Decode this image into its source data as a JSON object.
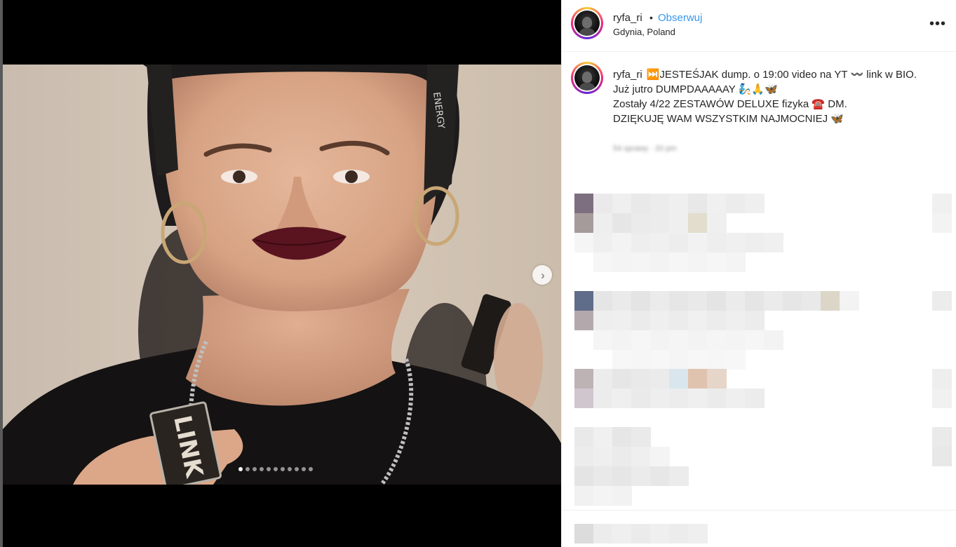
{
  "post": {
    "username": "ryfa_ri",
    "separator": "•",
    "follow_label": "Obserwuj",
    "location": "Gdynia, Poland",
    "more_icon": "more-options-icon",
    "caption": {
      "username": "ryfa_ri",
      "line1": "⏭️JESTEŚJAK dump. o 19:00 video na YT 〰️ link w BIO.",
      "line2": "Już jutro DUMPDAAAAAY 🧞🙏🦋",
      "line3": "Zostały 4/22 ZESTAWÓW DELUXE fizyka ☎️ DM.",
      "line4": "DZIĘKUJĘ WAM WSZYSTKIM NAJMOCNIEJ 🦋"
    },
    "timestamp": "54 sprawy · 20 pm"
  },
  "media": {
    "next_icon": "chevron-right-icon",
    "pendant_text": "LINK",
    "carousel": {
      "count": 11,
      "active_index": 0
    }
  },
  "colors": {
    "link": "#3897f0",
    "text": "#262626",
    "muted": "#8e8e8e",
    "border": "#efefef"
  }
}
